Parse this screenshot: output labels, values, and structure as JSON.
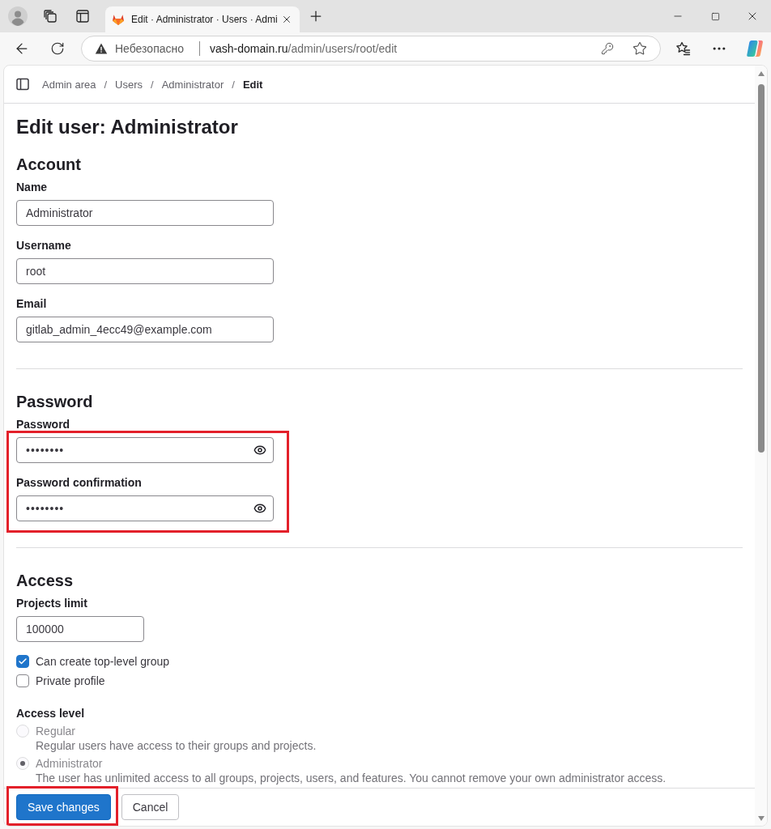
{
  "browser": {
    "tab": {
      "title": "Edit · Administrator · Users · Admi",
      "selected": true
    },
    "address_bar": {
      "security_label": "Небезопасно",
      "host": "vash-domain.ru",
      "path": "/admin/users/root/edit"
    }
  },
  "breadcrumbs": [
    {
      "label": "Admin area",
      "current": false
    },
    {
      "separator": "/",
      "label": "Users",
      "current": false
    },
    {
      "separator": "/",
      "label": "Administrator",
      "current": false
    },
    {
      "separator": "/",
      "label": "Edit",
      "current": true
    }
  ],
  "page_title": "Edit user: Administrator",
  "sections": [
    {
      "title": "Account",
      "highlighted": false,
      "items": [
        {
          "kind": "text",
          "label": "Name",
          "value": "Administrator"
        },
        {
          "kind": "text",
          "label": "Username",
          "value": "root"
        },
        {
          "kind": "text",
          "label": "Email",
          "value": "gitlab_admin_4ecc49@example.com"
        }
      ]
    },
    {
      "title": "Password",
      "highlighted": true,
      "items": [
        {
          "kind": "password",
          "label": "Password",
          "value": "••••••••"
        },
        {
          "kind": "password",
          "label": "Password confirmation",
          "value": "••••••••"
        }
      ]
    },
    {
      "title": "Access",
      "highlighted": false,
      "items": [
        {
          "kind": "number",
          "label": "Projects limit",
          "value": "100000"
        },
        {
          "kind": "checkbox",
          "label": "Can create top-level group",
          "checked": true
        },
        {
          "kind": "checkbox",
          "label": "Private profile",
          "checked": false
        },
        {
          "kind": "radio_group",
          "label": "Access level",
          "options": [
            {
              "label": "Regular",
              "description": "Regular users have access to their groups and projects.",
              "selected": false,
              "disabled": true
            },
            {
              "label": "Administrator",
              "description": "The user has unlimited access to all groups, projects, users, and features. You cannot remove your own administrator access.",
              "selected": true,
              "disabled": true
            }
          ]
        }
      ]
    }
  ],
  "footer": {
    "buttons": [
      {
        "kind": "primary",
        "label": "Save changes",
        "highlighted": true
      },
      {
        "kind": "secondary",
        "label": "Cancel",
        "highlighted": false
      }
    ]
  }
}
